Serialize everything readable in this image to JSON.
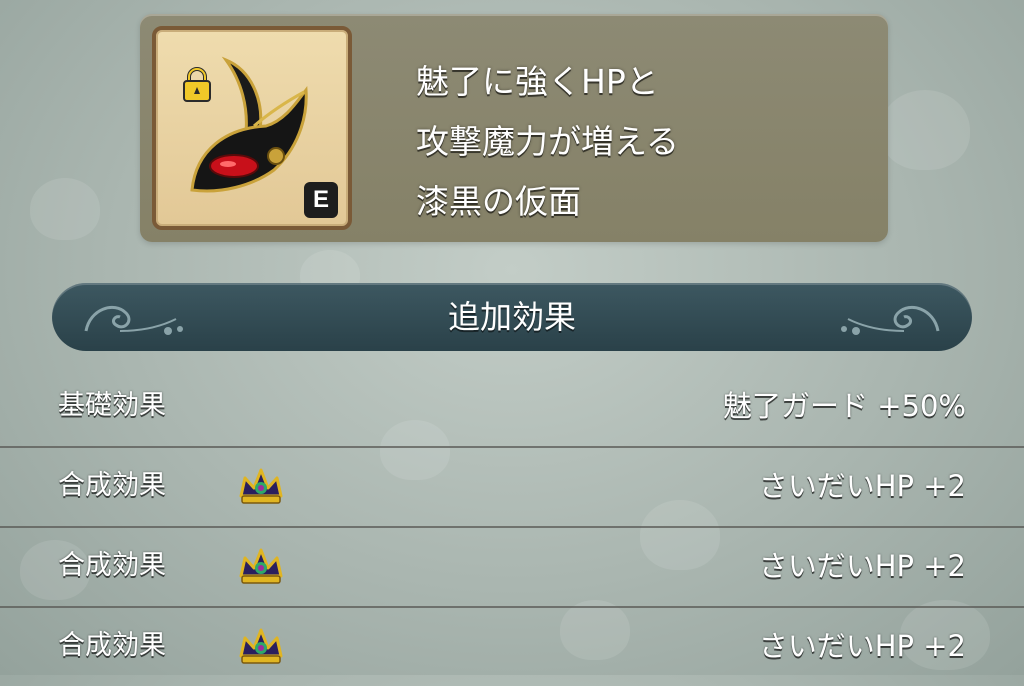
{
  "item": {
    "equipped_badge": "E",
    "description_lines": [
      "魅了に強くHPと",
      "攻撃魔力が増える",
      "漆黒の仮面"
    ],
    "icon": "black-mask-icon",
    "locked": true
  },
  "section": {
    "title": "追加効果"
  },
  "effects": [
    {
      "label": "基礎効果",
      "value": "魅了ガード +50%",
      "crown": false
    },
    {
      "label": "合成効果",
      "value": "さいだいHP +2",
      "crown": true
    },
    {
      "label": "合成効果",
      "value": "さいだいHP +2",
      "crown": true
    },
    {
      "label": "合成効果",
      "value": "さいだいHP +2",
      "crown": true
    }
  ],
  "colors": {
    "card_bg": "#8a8670",
    "header_bg": "#2f4a52",
    "icon_frame": "#e8d3a3",
    "background": "#b4c0ba"
  }
}
